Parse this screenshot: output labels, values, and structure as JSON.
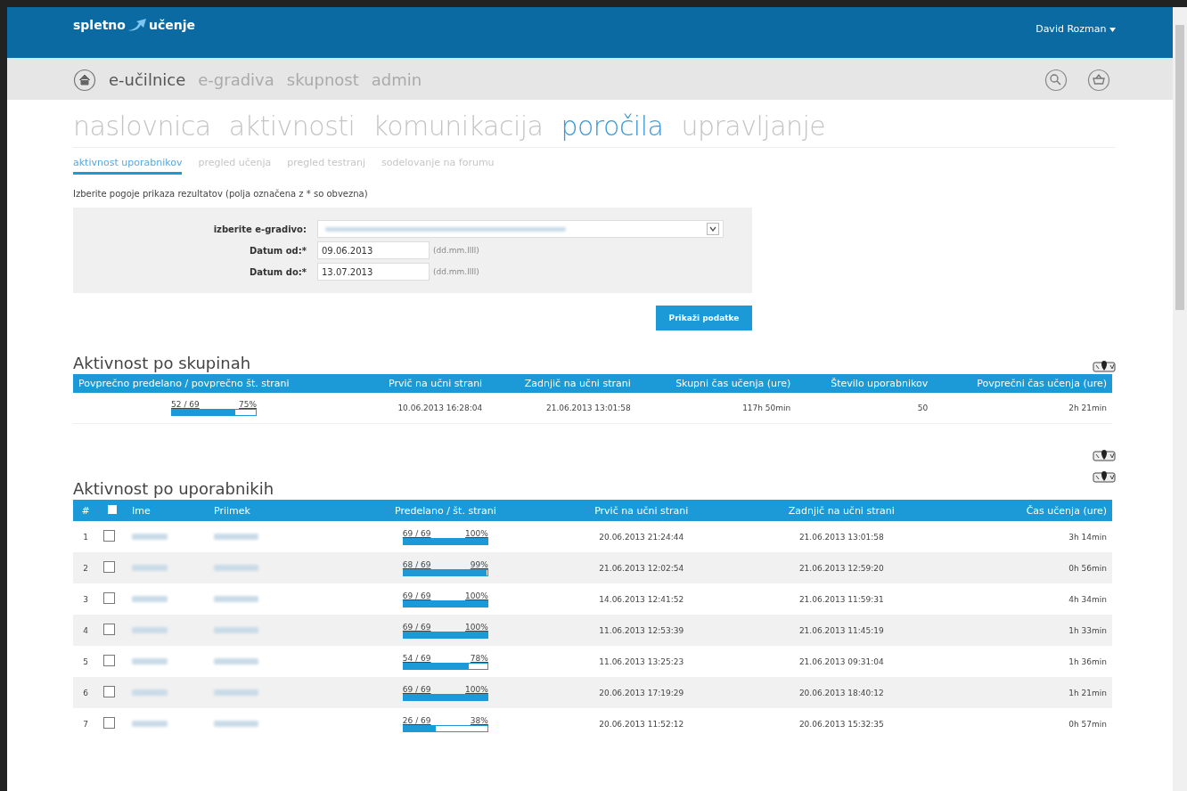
{
  "header": {
    "logo_left": "spletno",
    "logo_right": "učenje",
    "user": "David Rozman"
  },
  "main_nav": [
    {
      "label": "e-učilnice",
      "selected": true
    },
    {
      "label": "e-gradiva",
      "selected": false
    },
    {
      "label": "skupnost",
      "selected": false
    },
    {
      "label": "admin",
      "selected": false
    }
  ],
  "tabs": [
    {
      "label": "naslovnica",
      "selected": false
    },
    {
      "label": "aktivnosti",
      "selected": false
    },
    {
      "label": "komunikacija",
      "selected": false
    },
    {
      "label": "poročila",
      "selected": true
    },
    {
      "label": "upravljanje",
      "selected": false
    }
  ],
  "sub_tabs": [
    {
      "label": "aktivnost uporabnikov",
      "selected": true
    },
    {
      "label": "pregled učenja",
      "selected": false
    },
    {
      "label": "pregled testranj",
      "selected": false
    },
    {
      "label": "sodelovanje na forumu",
      "selected": false
    }
  ],
  "instructions": "Izberite pogoje prikaza rezultatov (polja označena z * so obvezna)",
  "form": {
    "fields": [
      {
        "kind": "select",
        "label": "izberite e-gradivo:"
      },
      {
        "kind": "date",
        "label": "Datum od:*",
        "value": "09.06.2013",
        "hint": "(dd.mm.llll)"
      },
      {
        "kind": "date",
        "label": "Datum do:*",
        "value": "13.07.2013",
        "hint": "(dd.mm.llll)"
      }
    ],
    "submit": "Prikaži podatke"
  },
  "group_section": {
    "title": "Aktivnost po skupinah",
    "columns": [
      "Povprečno predelano / povprečno št. strani",
      "Prvič na učni strani",
      "Zadnjič na učni strani",
      "Skupni čas učenja (ure)",
      "Število uporabnikov",
      "Povprečni čas učenja (ure)"
    ],
    "row": {
      "pages": "52 / 69",
      "percent": "75%",
      "level": 0.75,
      "first": "10.06.2013 16:28:04",
      "last": "21.06.2013 13:01:58",
      "total_time": "117h 50min",
      "users": "50",
      "avg_time": "2h 21min"
    }
  },
  "user_section": {
    "title": "Aktivnost po uporabnikih",
    "select_all_checked": false,
    "columns": [
      "#",
      "Ime",
      "Priimek",
      "Predelano / št. strani",
      "Prvič na učni strani",
      "Zadnjič na učni strani",
      "Čas učenja (ure)"
    ],
    "rows": [
      {
        "index": "1",
        "checked": false,
        "pages": "69 / 69",
        "percent": "100%",
        "level": 1,
        "first": "20.06.2013 21:24:44",
        "last": "21.06.2013 13:01:58",
        "time": "3h 14min"
      },
      {
        "index": "2",
        "checked": false,
        "pages": "68 / 69",
        "percent": "99%",
        "level": 0.99,
        "first": "21.06.2013 12:02:54",
        "last": "21.06.2013 12:59:20",
        "time": "0h 56min"
      },
      {
        "index": "3",
        "checked": false,
        "pages": "69 / 69",
        "percent": "100%",
        "level": 1,
        "first": "14.06.2013 12:41:52",
        "last": "21.06.2013 11:59:31",
        "time": "4h 34min"
      },
      {
        "index": "4",
        "checked": false,
        "pages": "69 / 69",
        "percent": "100%",
        "level": 1,
        "first": "11.06.2013 12:53:39",
        "last": "21.06.2013 11:45:19",
        "time": "1h 33min"
      },
      {
        "index": "5",
        "checked": false,
        "pages": "54 / 69",
        "percent": "78%",
        "level": 0.78,
        "first": "11.06.2013 13:25:23",
        "last": "21.06.2013 09:31:04",
        "time": "1h 36min"
      },
      {
        "index": "6",
        "checked": false,
        "pages": "69 / 69",
        "percent": "100%",
        "level": 1,
        "first": "20.06.2013 17:19:29",
        "last": "20.06.2013 18:40:12",
        "time": "1h 21min"
      },
      {
        "index": "7",
        "checked": false,
        "pages": "26 / 69",
        "percent": "38%",
        "level": 0.38,
        "first": "20.06.2013 11:52:12",
        "last": "20.06.2013 15:32:35",
        "time": "0h 57min"
      }
    ]
  }
}
